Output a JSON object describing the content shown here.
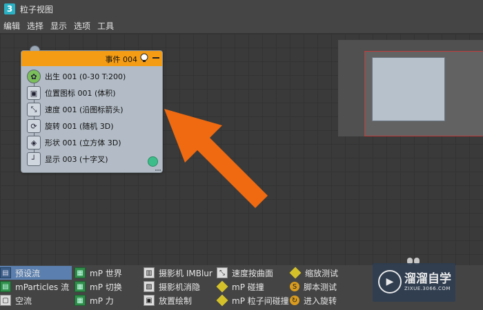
{
  "window": {
    "app_icon": "3",
    "title": "粒子视图"
  },
  "menu": [
    "编辑",
    "选择",
    "显示",
    "选项",
    "工具"
  ],
  "event_node": {
    "title": "事件 004",
    "header_color": "#f49c14",
    "operators": [
      {
        "icon": "birth-icon",
        "label": "出生 001 (0-30 T:200)"
      },
      {
        "icon": "position-icon",
        "label": "位置图标 001 (体积)"
      },
      {
        "icon": "speed-icon",
        "label": "速度 001 (沿图标箭头)"
      },
      {
        "icon": "rotation-icon",
        "label": "旋转 001 (随机 3D)"
      },
      {
        "icon": "shape-icon",
        "label": "形状 001 (立方体 3D)"
      },
      {
        "icon": "display-icon",
        "label": "显示 003 (十字叉)"
      }
    ]
  },
  "annotation_arrow_color": "#ef6a10",
  "depot": {
    "col1": [
      "预设流",
      "mParticles 流",
      "空流"
    ],
    "col2": [
      "mP 世界",
      "mP 切换",
      "mP 力"
    ],
    "col3": [
      "摄影机 IMBlur",
      "摄影机消隐",
      "放置绘制"
    ],
    "col4": [
      "速度按曲面",
      "mP 碰撞",
      "mP 粒子间碰撞"
    ],
    "col5": [
      "缩放测试",
      "脚本测试",
      "进入旋转"
    ]
  },
  "watermark": {
    "logo": "▶",
    "name": "溜溜自学",
    "url": "ZIXUE.3066.COM"
  }
}
